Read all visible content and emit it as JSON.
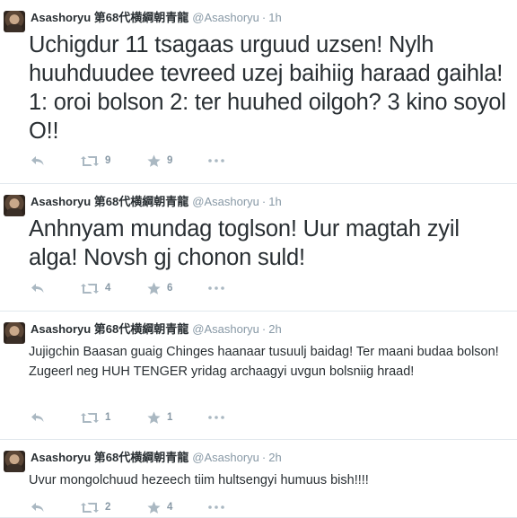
{
  "colors": {
    "name": "#292f33",
    "muted": "#8899a6",
    "icon": "#aab8c2",
    "divider": "#e1e8ed"
  },
  "tweets": [
    {
      "name": "Asashoryu 第68代横綱朝青龍",
      "handle": "@Asashoryu",
      "time": "1h",
      "text": "Uchigdur 11 tsagaas urguud uzsen! Nylh huuhduudee tevreed uzej baihiig haraad gaihla! 1: oroi bolson 2: ter huuhed oilgoh? 3 kino soyol O!!",
      "retweets": "9",
      "favorites": "9"
    },
    {
      "name": "Asashoryu 第68代横綱朝青龍",
      "handle": "@Asashoryu",
      "time": "1h",
      "text": "Anhnyam mundag toglson! Uur magtah zyil alga! Novsh gj chonon suld!",
      "retweets": "4",
      "favorites": "6"
    },
    {
      "name": "Asashoryu 第68代横綱朝青龍",
      "handle": "@Asashoryu",
      "time": "2h",
      "text": "Jujigchin Baasan guaig Chinges haanaar tusuulj baidag! Ter maani budaa bolson! Zugeerl neg HUH TENGER yridag archaagyi uvgun bolsniig hraad!",
      "retweets": "1",
      "favorites": "1"
    },
    {
      "name": "Asashoryu 第68代横綱朝青龍",
      "handle": "@Asashoryu",
      "time": "2h",
      "text": "Uvur mongolchuud hezeech tiim hultsengyi humuus bish!!!!",
      "retweets": "2",
      "favorites": "4"
    }
  ],
  "icons": {
    "reply": "reply-icon",
    "retweet": "retweet-icon",
    "favorite": "star-icon",
    "more": "more-icon"
  }
}
